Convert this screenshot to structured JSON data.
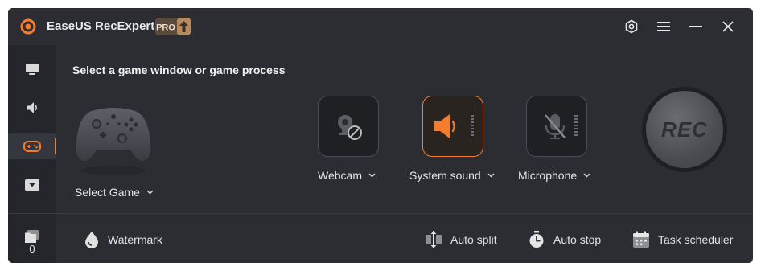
{
  "app": {
    "title": "EaseUS RecExperts",
    "pro_badge": "PRO"
  },
  "titlebar_buttons": [
    "settings-icon",
    "menu-icon",
    "minimize-icon",
    "close-icon"
  ],
  "sidebar": {
    "items": [
      {
        "name": "screen",
        "icon": "monitor-icon"
      },
      {
        "name": "audio",
        "icon": "speaker-icon"
      },
      {
        "name": "game",
        "icon": "gamepad-icon",
        "active": true
      },
      {
        "name": "more",
        "icon": "dropdown-icon"
      }
    ],
    "recordings_count": "0"
  },
  "main": {
    "heading": "Select a game window or game process",
    "select_game_label": "Select Game",
    "sources": [
      {
        "label": "Webcam",
        "enabled": false
      },
      {
        "label": "System sound",
        "enabled": true
      },
      {
        "label": "Microphone",
        "enabled": false
      }
    ],
    "rec_label": "REC"
  },
  "bottom_bar": {
    "watermark": "Watermark",
    "auto_split": "Auto split",
    "auto_stop": "Auto stop",
    "task_scheduler": "Task scheduler"
  },
  "colors": {
    "accent": "#f57c2d",
    "window_bg": "#2b2d33",
    "sidebar_bg": "#24262b"
  }
}
